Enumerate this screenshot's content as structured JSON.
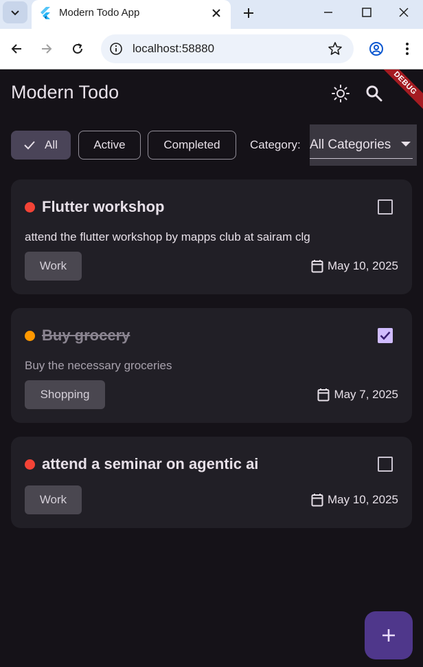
{
  "browser": {
    "tab_title": "Modern Todo App",
    "url": "localhost:58880"
  },
  "app": {
    "title": "Modern Todo",
    "debug_label": "DEBUG",
    "filters": [
      {
        "label": "All",
        "selected": true
      },
      {
        "label": "Active",
        "selected": false
      },
      {
        "label": "Completed",
        "selected": false
      }
    ],
    "category_label": "Category:",
    "category_value": "All Categories",
    "todos": [
      {
        "title": "Flutter workshop",
        "description": "attend the flutter workshop by mapps club at sairam clg",
        "category": "Work",
        "date": "May 10, 2025",
        "priority_color": "#f44336",
        "completed": false
      },
      {
        "title": "Buy grocery",
        "description": "Buy the necessary groceries",
        "category": "Shopping",
        "date": "May 7, 2025",
        "priority_color": "#ff9800",
        "completed": true
      },
      {
        "title": "attend a seminar on agentic ai",
        "description": "",
        "category": "Work",
        "date": "May 10, 2025",
        "priority_color": "#f44336",
        "completed": false
      }
    ],
    "fab_icon": "plus-icon"
  },
  "colors": {
    "background": "#151218",
    "card": "#211f26",
    "accent": "#d0bcff",
    "fab": "#4f378b"
  }
}
